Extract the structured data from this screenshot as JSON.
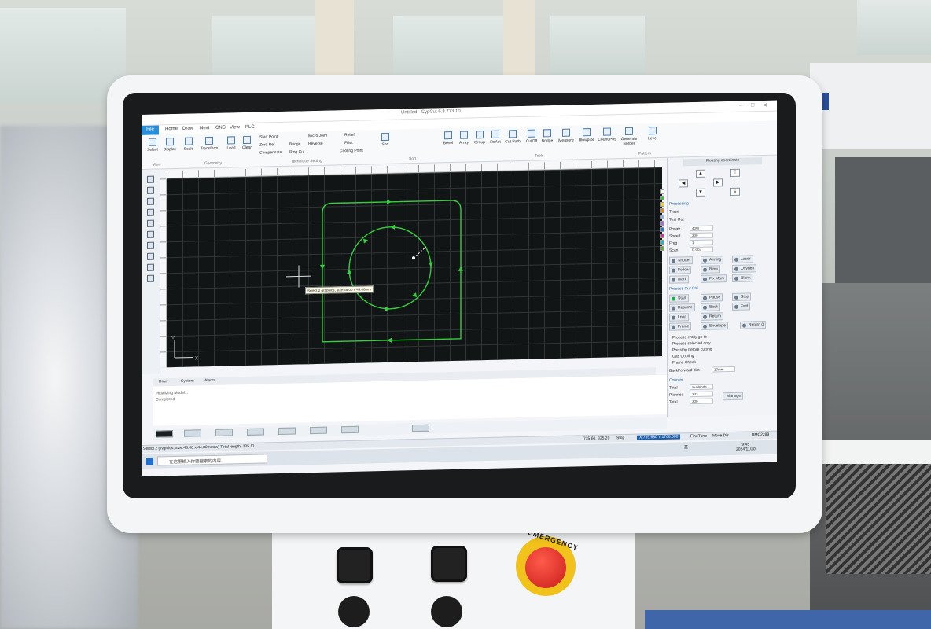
{
  "software": {
    "title": "Untitled - CypCut 6.3.773.10",
    "tabs": [
      "File",
      "Home",
      "Draw",
      "Nest",
      "CNC",
      "View",
      "PLC"
    ],
    "ribbon_buttons": [
      "Select",
      "Display",
      "Scale",
      "Transform",
      "Lead",
      "Clear",
      "Compensate",
      "Start Point",
      "Micro Joint",
      "Relief",
      "Zero Ref",
      "Bridge",
      "Reverse",
      "Fillet",
      "Ring Cut",
      "Cooling Point",
      "Sort",
      "Bevel",
      "Array",
      "Group",
      "ReAct",
      "Cut Path",
      "CutOff",
      "Bridge",
      "Measure",
      "Blowpipe",
      "Count/Pos",
      "Generate Border",
      "Level"
    ],
    "ribbon_groups": [
      "View",
      "Geometry",
      "Technique Setting",
      "Sort",
      "Tools",
      "Pattern"
    ],
    "tooltip": "Select 2 graphics, size:48.00 x 44.00mm",
    "log_tabs": [
      "Draw",
      "System",
      "Alarm"
    ],
    "log_lines": [
      "Initializing Model...",
      "Completed"
    ],
    "status": {
      "left": "Select 2 graphics, size:48.00 x 44.00mm(w) Total length: 335.11",
      "coords": "735.60, 325.20",
      "state": "Stop",
      "pos": "X:735.680 Y:1768.500",
      "finetune": "FineTune",
      "movedis": "Move Dis",
      "device": "BMC2289"
    },
    "taskbar": {
      "search": "在这里输入你要搜索的内容",
      "time": "9:45",
      "date": "2024/11/20",
      "lang": "英"
    },
    "right_panel": {
      "title": "Floating coordinate",
      "section1": "Processing",
      "trace": "Trace",
      "test_out": "Test Out",
      "rows": [
        {
          "label": "Power",
          "val": "40W"
        },
        {
          "label": "Speed",
          "val": "300"
        },
        {
          "label": "Freq",
          "val": "1"
        },
        {
          "label": "Scan",
          "val": "C.003"
        }
      ],
      "buttons": [
        "Shutter",
        "Aiming",
        "Follow",
        "Blow",
        "Oxygen",
        "Laser",
        "Mark",
        "Fix Mark",
        "Blank"
      ],
      "section2": "Process Cur Ctrl",
      "run_buttons": [
        "Start",
        "Pause",
        "Stop",
        "Resume",
        "Back",
        "Fwd",
        "Loop",
        "Return",
        "Frame",
        "Envelope",
        "Return 0"
      ],
      "options": [
        "Process entity go to",
        "Process selected only",
        "Pre-stop before cutting",
        "Gas Cooling",
        "Frame Check"
      ],
      "backward": "BackForward dist",
      "backward_val": "10mm",
      "counter": "Counter",
      "counter_rows": [
        {
          "label": "Total",
          "val": "SubNode"
        },
        {
          "label": "Planned",
          "val": "333"
        },
        {
          "label": "Total",
          "val": "300"
        }
      ],
      "manage": "Manage"
    }
  },
  "colors": {
    "canvas": "#121516",
    "path": "#33d03c",
    "accent": "#2b8fd8",
    "estop": "#d42c22",
    "estop_ring": "#f1c21b"
  },
  "panel": {
    "estop_label": "EMERGENCY"
  }
}
